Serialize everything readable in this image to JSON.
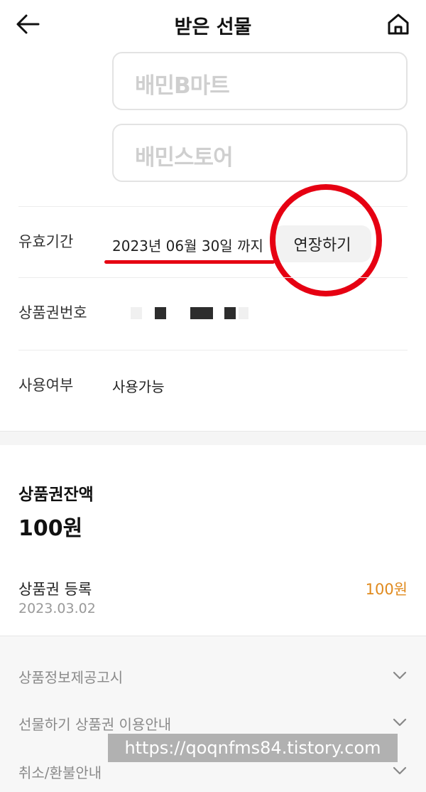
{
  "header": {
    "title": "받은 선물",
    "back_icon": "arrow-left-icon",
    "home_icon": "home-icon"
  },
  "brands": [
    {
      "label": "배민B마트"
    },
    {
      "label": "배민스토어"
    }
  ],
  "details": {
    "validity_label": "유효기간",
    "validity_value": "2023년 06월 30일 까지",
    "extend_button": "연장하기",
    "coupon_number_label": "상품권번호",
    "usage_label": "사용여부",
    "usage_value": "사용가능"
  },
  "balance": {
    "title": "상품권잔액",
    "amount": "100원"
  },
  "history": [
    {
      "label": "상품권 등록",
      "date": "2023.03.02",
      "amount": "100원"
    }
  ],
  "info_sections": [
    {
      "label": "상품정보제공고시"
    },
    {
      "label": "선물하기 상품권 이용안내"
    },
    {
      "label": "취소/환불안내"
    }
  ],
  "watermark": "https://qoqnfms84.tistory.com",
  "colors": {
    "accent_orange": "#e08a1e",
    "annotation_red": "#e60012"
  }
}
